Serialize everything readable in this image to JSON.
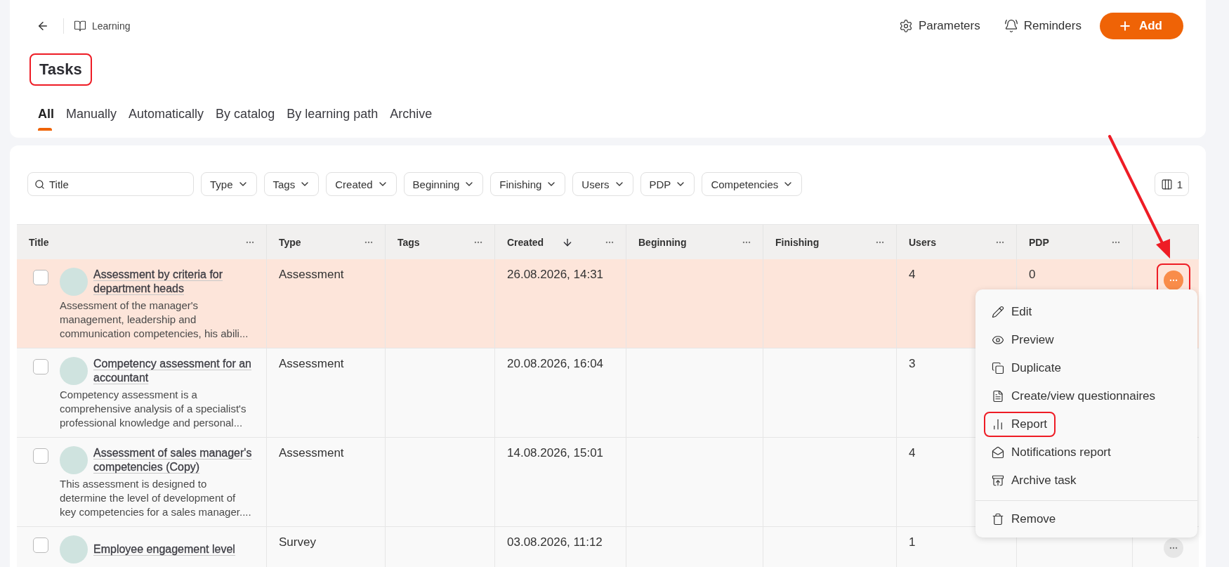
{
  "breadcrumb": {
    "label": "Learning"
  },
  "header_actions": [
    {
      "label": "Parameters",
      "kind": "settings"
    },
    {
      "label": "Reminders",
      "kind": "reminders"
    },
    {
      "label": "Add",
      "kind": "primary"
    }
  ],
  "page_title": {
    "text": "Tasks",
    "highlighted": true
  },
  "tabs": [
    {
      "label": "All",
      "selected": true
    },
    {
      "label": "Manually",
      "selected": false
    },
    {
      "label": "Automatically",
      "selected": false
    },
    {
      "label": "By catalog",
      "selected": false
    },
    {
      "label": "By learning path",
      "selected": false
    },
    {
      "label": "Archive",
      "selected": false
    }
  ],
  "search": {
    "placeholder": "Title"
  },
  "filters": [
    "Type",
    "Tags",
    "Created",
    "Beginning",
    "Finishing",
    "Users",
    "PDP",
    "Competencies"
  ],
  "columns_button": {
    "label": "1"
  },
  "table": {
    "columns": [
      {
        "label": "Title",
        "sorted": false
      },
      {
        "label": "Type",
        "sorted": false
      },
      {
        "label": "Tags",
        "sorted": false
      },
      {
        "label": "Created",
        "sorted": true
      },
      {
        "label": "Beginning",
        "sorted": false
      },
      {
        "label": "Finishing",
        "sorted": false
      },
      {
        "label": "Users",
        "sorted": false
      },
      {
        "label": "PDP",
        "sorted": false
      }
    ],
    "rows": [
      {
        "checked": false,
        "active": true,
        "title": "Assessment by criteria for department heads",
        "description": "Assessment of the manager's management, leadership and communication competencies, his abili...",
        "type": "Assessment",
        "created": "26.08.2026, 14:31",
        "users": "4",
        "pdp": "0",
        "menu_open": true,
        "highlighted": true
      },
      {
        "checked": false,
        "active": false,
        "title": "Competency assessment for an accountant",
        "description": "Competency assessment is a comprehensive analysis of a specialist's professional knowledge and personal...",
        "type": "Assessment",
        "created": "20.08.2026, 16:04",
        "users": "3"
      },
      {
        "checked": false,
        "active": false,
        "title": "Assessment of sales manager's competencies (Copy)",
        "description": "This assessment is designed to determine the level of development of key competencies for a sales manager....",
        "type": "Assessment",
        "created": "14.08.2026, 15:01",
        "users": "4"
      },
      {
        "checked": false,
        "active": false,
        "title": "Employee engagement level",
        "type": "Survey",
        "created": "03.08.2026, 11:12",
        "users": "1",
        "menu_open": false,
        "highlighted": false
      }
    ]
  },
  "row_menu": {
    "items": [
      {
        "label": "Edit",
        "kind": "edit",
        "highlighted": false
      },
      {
        "label": "Preview",
        "kind": "preview",
        "highlighted": false
      },
      {
        "label": "Duplicate",
        "kind": "duplicate",
        "highlighted": false
      },
      {
        "label": "Create/view questionnaires",
        "kind": "questionnaires",
        "highlighted": false
      },
      {
        "label": "Report",
        "kind": "report",
        "highlighted": true
      },
      {
        "label": "Notifications report",
        "kind": "notifications",
        "highlighted": false
      },
      {
        "label": "Archive task",
        "kind": "archive",
        "highlighted": false
      }
    ],
    "footer_items": [
      {
        "label": "Remove",
        "kind": "remove",
        "highlighted": false
      }
    ]
  }
}
